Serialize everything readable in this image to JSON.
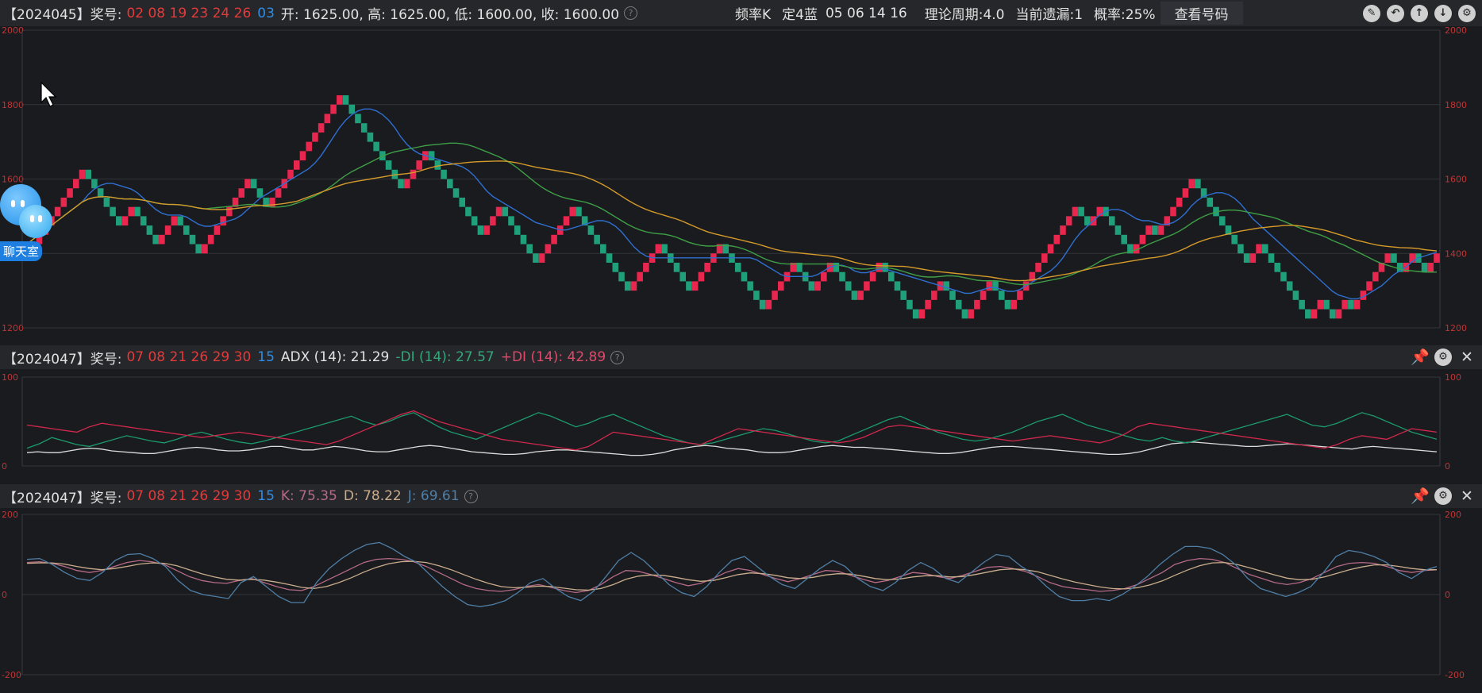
{
  "header1": {
    "period": "【2024045】奖号:",
    "red_balls": "02 08 19 23 24 26",
    "blue_ball": "03",
    "ohlc": "开: 1625.00, 高: 1625.00, 低: 1600.00, 收: 1600.00",
    "freq_label": "频率K",
    "fix_label": "定4蓝",
    "fix_numbers": "05 06 14 16",
    "cycle": "理论周期:4.0",
    "miss": "当前遗漏:1",
    "prob": "概率:25%",
    "view_button": "查看号码"
  },
  "header2": {
    "period": "【2024047】奖号:",
    "red_balls": "07 08 21 26 29 30",
    "blue_ball": "15",
    "adx": "ADX (14): 21.29",
    "minus_di": "-DI (14): 27.57",
    "plus_di": "+DI (14): 42.89"
  },
  "header3": {
    "period": "【2024047】奖号:",
    "red_balls": "07 08 21 26 29 30",
    "blue_ball": "15",
    "k": "K: 75.35",
    "d": "D: 78.22",
    "j": "J: 69.61"
  },
  "chat_widget": {
    "label": "聊天室"
  },
  "colors": {
    "up": "#e8264e",
    "down": "#1fa07a",
    "ma_blue": "#2f6fd0",
    "ma_green": "#3ea046",
    "ma_orange": "#d49a2a",
    "adx": "#dcdcdc",
    "minus_di": "#1c9a6c",
    "plus_di": "#d0284c",
    "k": "#b56a86",
    "d": "#c9ad8c",
    "j": "#4f7fa6"
  },
  "icons": [
    "edit-icon",
    "back-icon",
    "up-icon",
    "down-icon",
    "settings-icon",
    "pin-icon",
    "close-icon"
  ],
  "chart_data": [
    {
      "type": "candlestick",
      "title": "频率K",
      "ylim": [
        1200,
        2000
      ],
      "yticks": [
        "2000",
        "1800",
        "1600",
        "1400",
        "1200"
      ],
      "close_series": [
        1400,
        1425,
        1450,
        1475,
        1500,
        1525,
        1550,
        1575,
        1600,
        1625,
        1600,
        1575,
        1550,
        1525,
        1500,
        1475,
        1500,
        1525,
        1500,
        1475,
        1450,
        1425,
        1450,
        1475,
        1500,
        1475,
        1450,
        1425,
        1400,
        1425,
        1450,
        1475,
        1500,
        1525,
        1550,
        1575,
        1600,
        1575,
        1550,
        1525,
        1550,
        1575,
        1600,
        1625,
        1650,
        1675,
        1700,
        1725,
        1750,
        1775,
        1800,
        1825,
        1800,
        1775,
        1750,
        1725,
        1700,
        1675,
        1650,
        1625,
        1600,
        1575,
        1600,
        1625,
        1650,
        1675,
        1650,
        1625,
        1600,
        1575,
        1550,
        1525,
        1500,
        1475,
        1450,
        1475,
        1500,
        1525,
        1500,
        1475,
        1450,
        1425,
        1400,
        1375,
        1400,
        1425,
        1450,
        1475,
        1500,
        1525,
        1500,
        1475,
        1450,
        1425,
        1400,
        1375,
        1350,
        1325,
        1300,
        1325,
        1350,
        1375,
        1400,
        1425,
        1400,
        1375,
        1350,
        1325,
        1300,
        1325,
        1350,
        1375,
        1400,
        1425,
        1400,
        1375,
        1350,
        1325,
        1300,
        1275,
        1250,
        1275,
        1300,
        1325,
        1350,
        1375,
        1350,
        1325,
        1300,
        1325,
        1350,
        1375,
        1350,
        1325,
        1300,
        1275,
        1300,
        1325,
        1350,
        1375,
        1350,
        1325,
        1300,
        1275,
        1250,
        1225,
        1250,
        1275,
        1300,
        1325,
        1300,
        1275,
        1250,
        1225,
        1250,
        1275,
        1300,
        1325,
        1300,
        1275,
        1250,
        1275,
        1300,
        1325,
        1350,
        1375,
        1400,
        1425,
        1450,
        1475,
        1500,
        1525,
        1500,
        1475,
        1500,
        1525,
        1500,
        1475,
        1450,
        1425,
        1400,
        1425,
        1450,
        1475,
        1450,
        1475,
        1500,
        1525,
        1550,
        1575,
        1600,
        1575,
        1550,
        1525,
        1500,
        1475,
        1450,
        1425,
        1400,
        1375,
        1400,
        1425,
        1400,
        1375,
        1350,
        1325,
        1300,
        1275,
        1250,
        1225,
        1250,
        1275,
        1250,
        1225,
        1250,
        1275,
        1250,
        1275,
        1300,
        1325,
        1350,
        1375,
        1400,
        1375,
        1350,
        1375,
        1400,
        1375,
        1350,
        1375,
        1400
      ]
    },
    {
      "type": "line",
      "title": "ADX",
      "ylim": [
        0,
        100
      ],
      "yticks": [
        "100",
        "0"
      ],
      "series": [
        {
          "name": "ADX (14)",
          "values": [
            15,
            16,
            15,
            15,
            17,
            19,
            20,
            19,
            17,
            16,
            15,
            14,
            14,
            16,
            18,
            20,
            21,
            20,
            18,
            17,
            17,
            18,
            20,
            22,
            22,
            20,
            18,
            18,
            20,
            22,
            21,
            19,
            17,
            16,
            16,
            18,
            20,
            22,
            23,
            22,
            20,
            18,
            16,
            15,
            14,
            13,
            13,
            14,
            16,
            17,
            18,
            18,
            17,
            16,
            15,
            14,
            13,
            12,
            12,
            13,
            15,
            18,
            20,
            22,
            23,
            22,
            20,
            19,
            18,
            16,
            15,
            15,
            16,
            18,
            20,
            22,
            23,
            22,
            21,
            21,
            20,
            19,
            18,
            17,
            16,
            15,
            14,
            14,
            15,
            17,
            19,
            21,
            22,
            22,
            21,
            20,
            19,
            18,
            17,
            16,
            15,
            14,
            13,
            13,
            14,
            16,
            19,
            22,
            25,
            26,
            27,
            26,
            25,
            24,
            23,
            22,
            22,
            23,
            24,
            25,
            24,
            23,
            22,
            21,
            20,
            19,
            21,
            22,
            21,
            20,
            19,
            18,
            17,
            16
          ]
        },
        {
          "name": "-DI (14)",
          "values": [
            20,
            25,
            32,
            28,
            24,
            22,
            26,
            30,
            34,
            31,
            28,
            26,
            30,
            35,
            38,
            34,
            30,
            27,
            25,
            28,
            32,
            36,
            40,
            44,
            48,
            52,
            56,
            50,
            46,
            50,
            56,
            60,
            52,
            44,
            38,
            34,
            30,
            36,
            42,
            48,
            54,
            60,
            56,
            50,
            44,
            48,
            54,
            58,
            52,
            46,
            40,
            34,
            30,
            26,
            24,
            26,
            30,
            34,
            38,
            42,
            40,
            36,
            32,
            28,
            26,
            28,
            34,
            40,
            46,
            52,
            56,
            50,
            44,
            38,
            34,
            30,
            28,
            30,
            34,
            38,
            44,
            50,
            54,
            58,
            52,
            46,
            42,
            38,
            34,
            30,
            28,
            32,
            28,
            26,
            30,
            34,
            38,
            42,
            46,
            50,
            54,
            58,
            52,
            46,
            44,
            48,
            54,
            60,
            56,
            50,
            44,
            38,
            34,
            30
          ]
        },
        {
          "name": "+DI (14)",
          "values": [
            46,
            44,
            42,
            40,
            38,
            44,
            48,
            46,
            44,
            42,
            40,
            38,
            36,
            34,
            32,
            34,
            36,
            38,
            36,
            34,
            32,
            30,
            28,
            26,
            24,
            28,
            34,
            40,
            46,
            52,
            58,
            62,
            56,
            50,
            46,
            42,
            38,
            34,
            30,
            28,
            26,
            24,
            22,
            20,
            18,
            22,
            30,
            38,
            36,
            34,
            32,
            30,
            28,
            26,
            24,
            30,
            36,
            42,
            40,
            38,
            36,
            34,
            32,
            30,
            28,
            26,
            28,
            32,
            38,
            44,
            46,
            44,
            42,
            40,
            38,
            36,
            34,
            32,
            30,
            28,
            30,
            32,
            34,
            32,
            30,
            28,
            26,
            30,
            36,
            44,
            48,
            46,
            44,
            42,
            40,
            38,
            36,
            34,
            32,
            30,
            28,
            26,
            24,
            22,
            20,
            24,
            30,
            34,
            32,
            30,
            36,
            42,
            40,
            38
          ]
        }
      ]
    },
    {
      "type": "line",
      "title": "KDJ",
      "ylim": [
        -200,
        200
      ],
      "yticks": [
        "200",
        "0",
        "-200"
      ],
      "series": [
        {
          "name": "K",
          "values": [
            80,
            82,
            78,
            70,
            60,
            55,
            60,
            70,
            80,
            85,
            82,
            75,
            60,
            45,
            35,
            30,
            28,
            35,
            40,
            30,
            20,
            12,
            10,
            20,
            35,
            50,
            65,
            80,
            88,
            90,
            88,
            82,
            70,
            55,
            40,
            25,
            15,
            10,
            8,
            12,
            20,
            25,
            18,
            10,
            5,
            10,
            25,
            45,
            60,
            58,
            50,
            40,
            30,
            22,
            28,
            40,
            55,
            65,
            60,
            50,
            40,
            32,
            40,
            50,
            60,
            58,
            48,
            38,
            30,
            35,
            45,
            55,
            52,
            45,
            40,
            48,
            58,
            68,
            70,
            65,
            58,
            45,
            30,
            20,
            15,
            12,
            8,
            10,
            15,
            25,
            40,
            55,
            75,
            85,
            90,
            88,
            80,
            65,
            50,
            40,
            30,
            25,
            30,
            40,
            55,
            70,
            78,
            80,
            78,
            70,
            60,
            55,
            60,
            62
          ]
        },
        {
          "name": "D",
          "values": [
            78,
            79,
            79,
            76,
            70,
            65,
            62,
            65,
            70,
            76,
            79,
            78,
            72,
            62,
            52,
            44,
            38,
            36,
            38,
            36,
            31,
            25,
            18,
            15,
            20,
            30,
            42,
            56,
            68,
            77,
            82,
            83,
            80,
            72,
            62,
            50,
            38,
            28,
            20,
            17,
            18,
            21,
            20,
            16,
            12,
            11,
            15,
            25,
            38,
            46,
            49,
            48,
            43,
            37,
            33,
            35,
            42,
            50,
            54,
            52,
            48,
            42,
            40,
            43,
            49,
            52,
            51,
            46,
            40,
            37,
            39,
            44,
            47,
            47,
            44,
            45,
            50,
            56,
            62,
            64,
            62,
            57,
            48,
            39,
            31,
            25,
            19,
            15,
            14,
            17,
            24,
            34,
            48,
            61,
            72,
            79,
            80,
            75,
            67,
            58,
            49,
            41,
            37,
            38,
            44,
            53,
            62,
            69,
            74,
            74,
            70,
            65,
            62,
            62
          ]
        },
        {
          "name": "J",
          "values": [
            88,
            90,
            75,
            55,
            40,
            35,
            55,
            85,
            100,
            102,
            90,
            70,
            35,
            10,
            0,
            -5,
            -10,
            30,
            45,
            20,
            -5,
            -20,
            -20,
            30,
            65,
            90,
            110,
            125,
            130,
            115,
            95,
            80,
            50,
            20,
            -5,
            -25,
            -30,
            -25,
            -15,
            5,
            30,
            40,
            15,
            -5,
            -15,
            8,
            45,
            85,
            105,
            85,
            55,
            25,
            5,
            -5,
            20,
            55,
            85,
            95,
            70,
            45,
            25,
            15,
            40,
            65,
            85,
            70,
            40,
            20,
            10,
            30,
            60,
            80,
            65,
            40,
            30,
            55,
            80,
            100,
            95,
            70,
            50,
            20,
            -5,
            -15,
            -15,
            -10,
            -15,
            0,
            20,
            45,
            75,
            100,
            120,
            120,
            115,
            100,
            75,
            40,
            15,
            5,
            -5,
            5,
            20,
            55,
            95,
            110,
            105,
            95,
            80,
            55,
            40,
            60,
            70
          ]
        }
      ]
    }
  ]
}
